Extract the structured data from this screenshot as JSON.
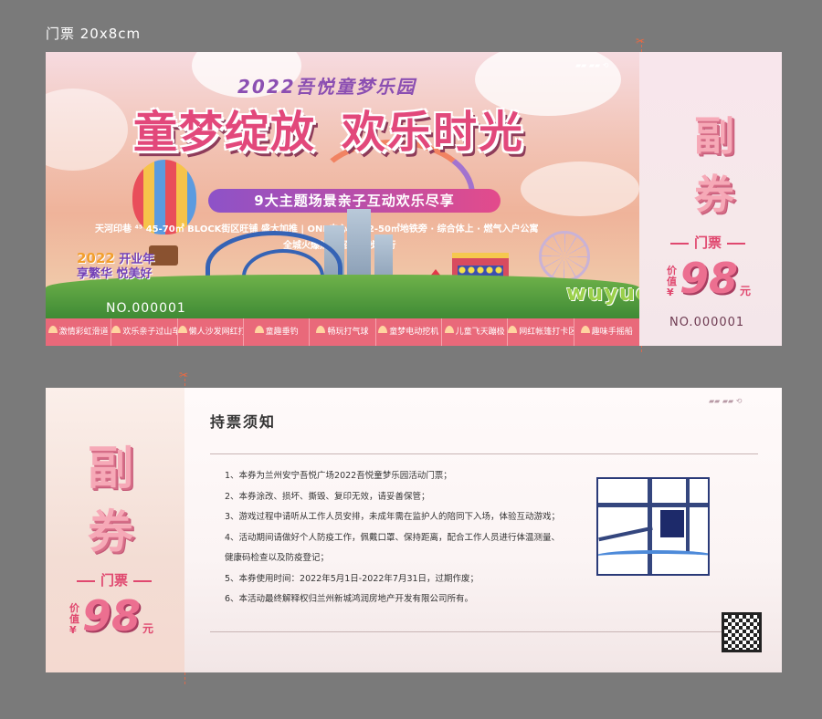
{
  "page_label": "门票  20x8cm",
  "front": {
    "small_title": "2022吾悦童梦乐园",
    "big_title_left": "童梦绽放",
    "big_title_right": "欢乐时光",
    "subtitle": "9大主题场景亲子互动欢乐尽享",
    "info_line": "天河印巷 ⁴⁵ 45-70㎡ BLOCK街区旺铺  盛大加推 | ONE中心 ⁴² 42-50㎡地铁旁 · 综合体上 · 燃气入户公寓",
    "info_line2": "全城火爆热销 招商同步进行",
    "opening_badge_year": "2022",
    "opening_badge_line1": "开业年",
    "opening_badge_line2": "享繁华 悦美好",
    "logo_text": "wuyue",
    "serial": "NO.000001",
    "attractions": [
      "激情彩虹滑道",
      "欢乐亲子过山车",
      "懒人沙发网红打卡区",
      "童趣垂钓",
      "畅玩打气球",
      "童梦电动挖机",
      "儿童飞天蹦极",
      "网红帐篷打卡区",
      "趣味手摇船"
    ]
  },
  "stub": {
    "fu": "副",
    "quan": "券",
    "ticket_label": "门票",
    "price_label_1": "价",
    "price_label_2": "值",
    "currency": "¥",
    "price": "98",
    "yuan": "元",
    "serial": "NO.000001"
  },
  "back": {
    "notice_title": "持票须知",
    "notices": [
      "1、本券为兰州安宁吾悦广场2022吾悦童梦乐园活动门票；",
      "2、本券涂改、损坏、撕毁、复印无效，请妥善保管；",
      "3、游戏过程中请听从工作人员安排，未成年需在监护人的陪同下入场，体验互动游戏；",
      "4、活动期间请做好个人防疫工作，佩戴口罩、保持距离，配合工作人员进行体温测量、",
      "    健康码检查以及防疫登记；",
      "5、本券使用时间：2022年5月1日-2022年7月31日，过期作废；",
      "6、本活动最终解释权归兰州新城鸿润房地产开发有限公司所有。"
    ]
  },
  "colors": {
    "pink_title": "#e2487b",
    "purple": "#8b4fb2",
    "band_coral": "#e9697a",
    "background": "#7a7a7a"
  }
}
